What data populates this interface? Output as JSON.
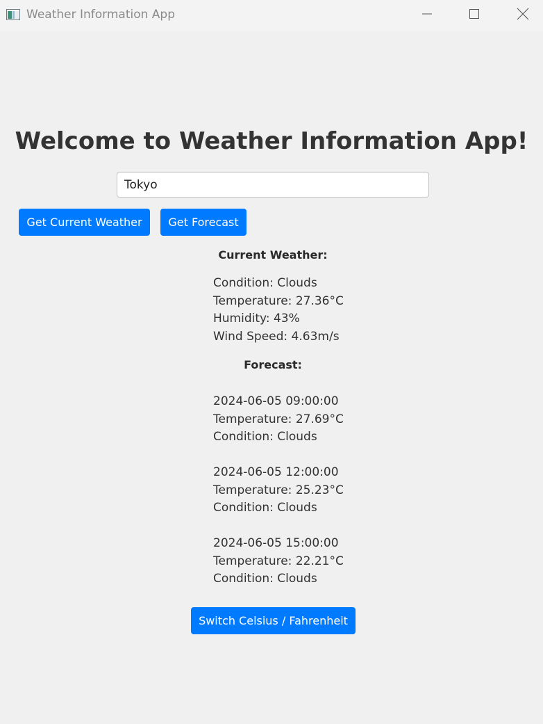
{
  "window": {
    "title": "Weather Information App",
    "icons": {
      "app": "app-window-icon",
      "minimize": "minimize-icon",
      "maximize": "maximize-icon",
      "close": "close-icon"
    }
  },
  "main": {
    "welcome": "Welcome to Weather Information App!",
    "city_input_value": "Tokyo",
    "buttons": {
      "current": "Get Current Weather",
      "forecast": "Get Forecast",
      "switch_units": "Switch Celsius / Fahrenheit"
    },
    "current_heading": "Current Weather:",
    "current": {
      "condition": "Condition: Clouds",
      "temperature": "Temperature: 27.36°C",
      "humidity": "Humidity: 43%",
      "wind": "Wind Speed: 4.63m/s"
    },
    "forecast_heading": "Forecast:",
    "forecast": [
      {
        "datetime": "2024-06-05 09:00:00",
        "temperature": "Temperature: 27.69°C",
        "condition": "Condition: Clouds"
      },
      {
        "datetime": "2024-06-05 12:00:00",
        "temperature": "Temperature: 25.23°C",
        "condition": "Condition: Clouds"
      },
      {
        "datetime": "2024-06-05 15:00:00",
        "temperature": "Temperature: 22.21°C",
        "condition": "Condition: Clouds"
      }
    ]
  },
  "colors": {
    "accent": "#007bff",
    "background": "#f0f0f0",
    "text": "#333333"
  }
}
